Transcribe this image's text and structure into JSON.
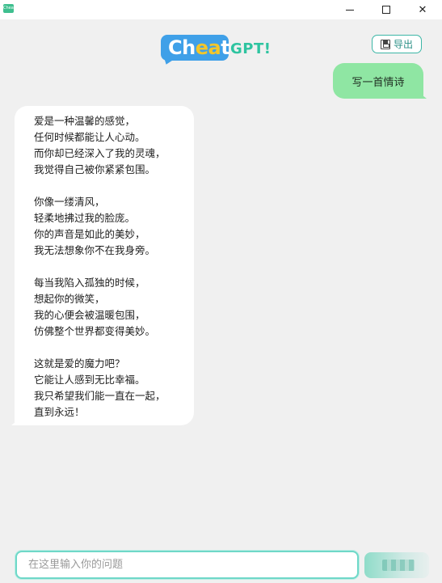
{
  "window": {
    "icon_label": "Cheat",
    "minimize_glyph": "",
    "maximize_glyph": "",
    "close_glyph": "✕"
  },
  "logo": {
    "word_before": "Ch",
    "word_highlight": "ea",
    "word_after": "t",
    "suffix": "GPT!"
  },
  "toolbar": {
    "export_label": "导出"
  },
  "chat": {
    "user_message": "写一首情诗",
    "bot_stanzas": [
      [
        "爱是一种温馨的感觉，",
        "任何时候都能让人心动。",
        "而你却已经深入了我的灵魂，",
        "我觉得自己被你紧紧包围。"
      ],
      [
        "你像一缕清风，",
        "轻柔地拂过我的脸庞。",
        "你的声音是如此的美妙，",
        "我无法想象你不在我身旁。"
      ],
      [
        "每当我陷入孤独的时候，",
        "想起你的微笑，",
        "我的心便会被温暖包围，",
        "仿佛整个世界都变得美妙。"
      ],
      [
        "这就是爱的魔力吧？",
        "它能让人感到无比幸福。",
        "我只希望我们能一直在一起，",
        "直到永远！"
      ]
    ]
  },
  "input": {
    "placeholder": "在这里输入你的问题",
    "value": ""
  },
  "colors": {
    "user_bubble": "#8fe6a3",
    "bot_bubble": "#ffffff",
    "accent": "#3cb6a6",
    "logo_blue": "#3fa0e8",
    "logo_yellow": "#f2c62b",
    "logo_green": "#2ec4a0"
  }
}
